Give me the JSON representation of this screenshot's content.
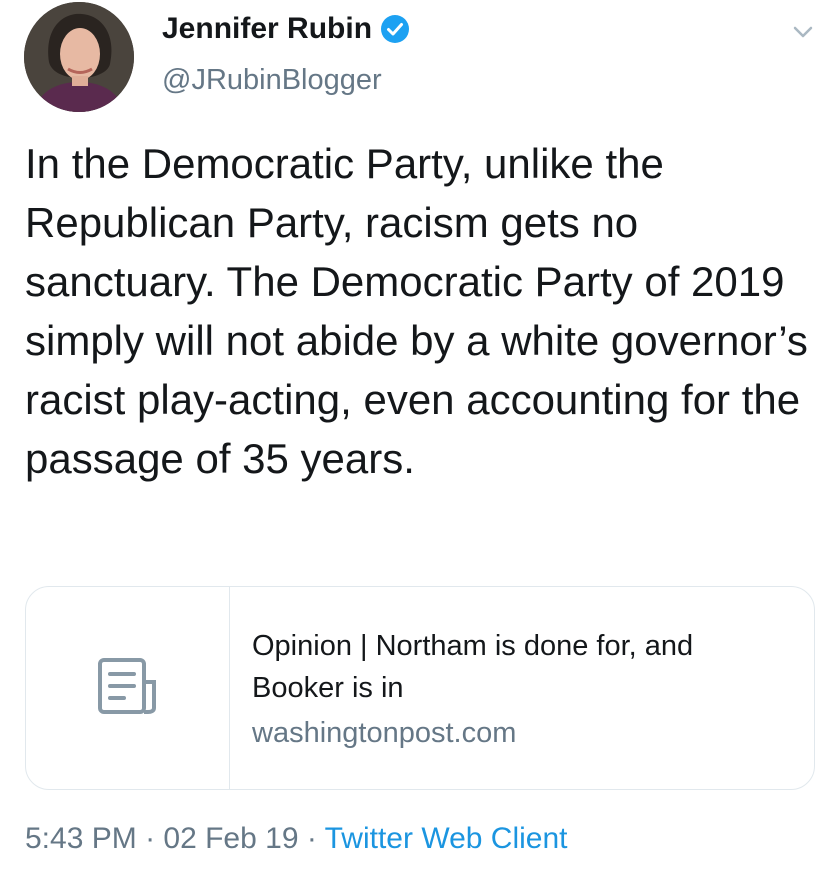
{
  "author": {
    "name": "Jennifer Rubin",
    "handle": "@JRubinBlogger",
    "verified": true
  },
  "tweet": {
    "text": "In the Democratic Party, unlike the Republican Party, racism gets no sanctuary. The Democratic Party of 2019 simply will not abide by a white governor’s racist play-acting, even accounting for the passage of 35 years."
  },
  "link_card": {
    "title": "Opinion | Northam is done for, and Booker is in",
    "domain": "washingtonpost.com",
    "icon": "document-icon"
  },
  "meta": {
    "time": "5:43 PM",
    "separator": " · ",
    "date": "02 Feb 19",
    "source": "Twitter Web Client"
  },
  "colors": {
    "text": "#14171a",
    "secondary": "#657786",
    "accent": "#1b95e0",
    "border": "#e1e8ed"
  }
}
